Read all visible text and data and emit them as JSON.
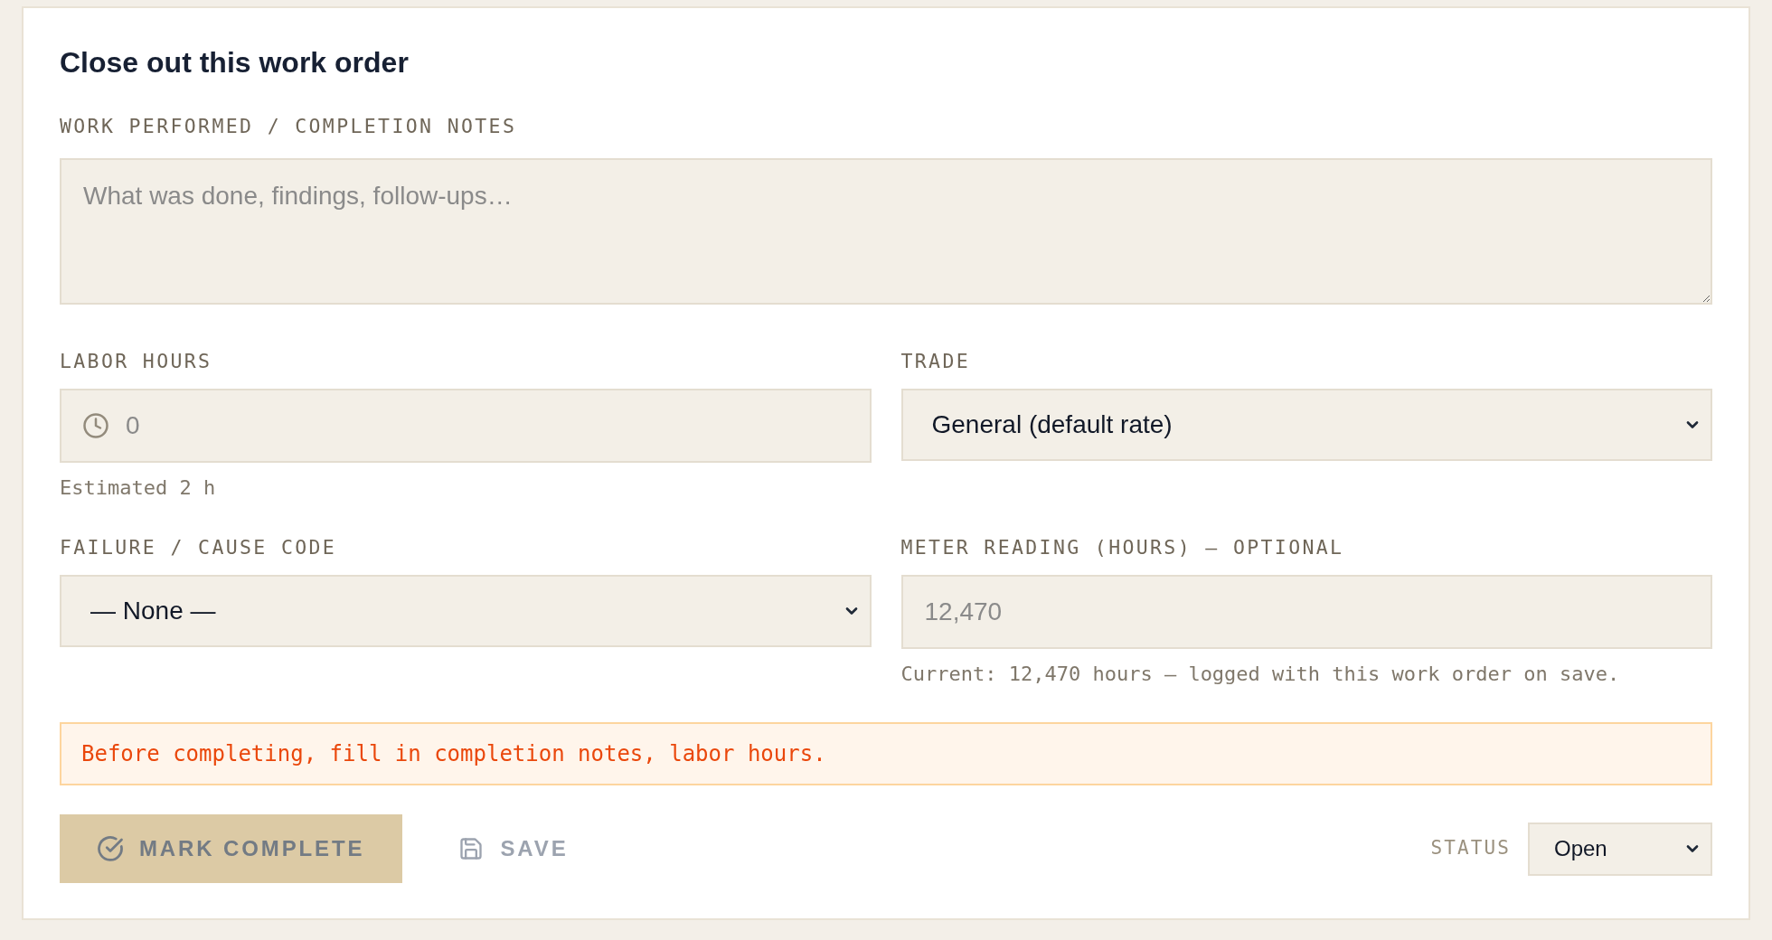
{
  "title": "Close out this work order",
  "notes": {
    "label": "WORK PERFORMED / COMPLETION NOTES",
    "placeholder": "What was done, findings, follow-ups…"
  },
  "fields": [
    {
      "kind": "hours",
      "label": "LABOR HOURS",
      "placeholder": "0",
      "hint": "Estimated 2 h"
    },
    {
      "kind": "select",
      "label": "TRADE",
      "value": "General (default rate)"
    },
    {
      "kind": "select",
      "label": "FAILURE / CAUSE CODE",
      "value": "— None —"
    },
    {
      "kind": "number",
      "label": "METER READING (HOURS) — OPTIONAL",
      "placeholder": "12,470",
      "hint": "Current: 12,470 hours — logged with this work order on save."
    }
  ],
  "warning": "Before completing, fill in completion notes, labor hours.",
  "actions": [
    {
      "kind": "primary",
      "label": "MARK COMPLETE",
      "disabled": true
    },
    {
      "kind": "secondary",
      "label": "SAVE",
      "disabled": true
    }
  ],
  "status": {
    "label": "STATUS",
    "value": "Open"
  }
}
